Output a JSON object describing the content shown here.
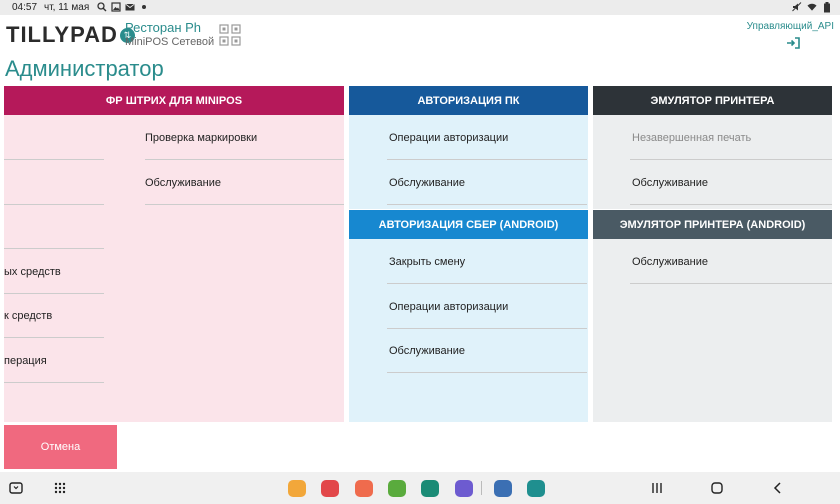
{
  "status_bar": {
    "time": "04:57",
    "date": "чт, 11 мая",
    "left_icons": [
      "search-icon",
      "image-icon",
      "mail-icon",
      "dot-icon"
    ],
    "right_icons": [
      "mute-icon",
      "wifi-icon",
      "battery-icon"
    ]
  },
  "header": {
    "logo_text": "TILLYPAD",
    "restaurant": "Ресторан Ph",
    "network": "MiniPOS Сетевой",
    "user": "Управляющий_API"
  },
  "page_title": "Администратор",
  "panels": {
    "fr": {
      "title": "ФР ШТРИХ ДЛЯ MINIPOS",
      "header_color": "#b5195a",
      "bg_color": "#fbe4ea",
      "right_items": [
        "Проверка маркировки",
        "Обслуживание"
      ],
      "left_items": [
        "ых средств",
        "к средств",
        "перация"
      ]
    },
    "auth_pc": {
      "title": "АВТОРИЗАЦИЯ ПК",
      "header_color": "#16599b",
      "bg_color": "#e0f2fa",
      "items": [
        "Операции авторизации",
        "Обслуживание"
      ]
    },
    "auth_sber": {
      "title": "АВТОРИЗАЦИЯ СБЕР (ANDROID)",
      "header_color": "#1788d0",
      "bg_color": "#e0f2fa",
      "items": [
        "Закрыть смену",
        "Операции авторизации",
        "Обслуживание"
      ]
    },
    "printer_emu": {
      "title": "ЭМУЛЯТОР ПРИНТЕРА",
      "header_color": "#2d3338",
      "bg_color": "#eceeef",
      "items": [
        "Незавершенная печать",
        "Обслуживание"
      ]
    },
    "printer_emu_android": {
      "title": "ЭМУЛЯТОР ПРИНТЕРА (ANDROID)",
      "header_color": "#4a5a64",
      "bg_color": "#eceeef",
      "items": [
        "Обслуживание"
      ]
    }
  },
  "cancel_label": "Отмена",
  "nav_apps": [
    {
      "name": "files-app-icon",
      "color": "#f2a73a"
    },
    {
      "name": "notes-app-icon",
      "color": "#e2474a"
    },
    {
      "name": "contacts-app-icon",
      "color": "#ef6b4d"
    },
    {
      "name": "calculator-app-icon",
      "color": "#5aab3d"
    },
    {
      "name": "calendar-app-icon",
      "color": "#1b8b76"
    },
    {
      "name": "internet-app-icon",
      "color": "#6d5bd0"
    },
    {
      "name": "settings-app-icon",
      "color": "#3b6fb3"
    },
    {
      "name": "tree-app-icon",
      "color": "#1f8f8f"
    }
  ]
}
